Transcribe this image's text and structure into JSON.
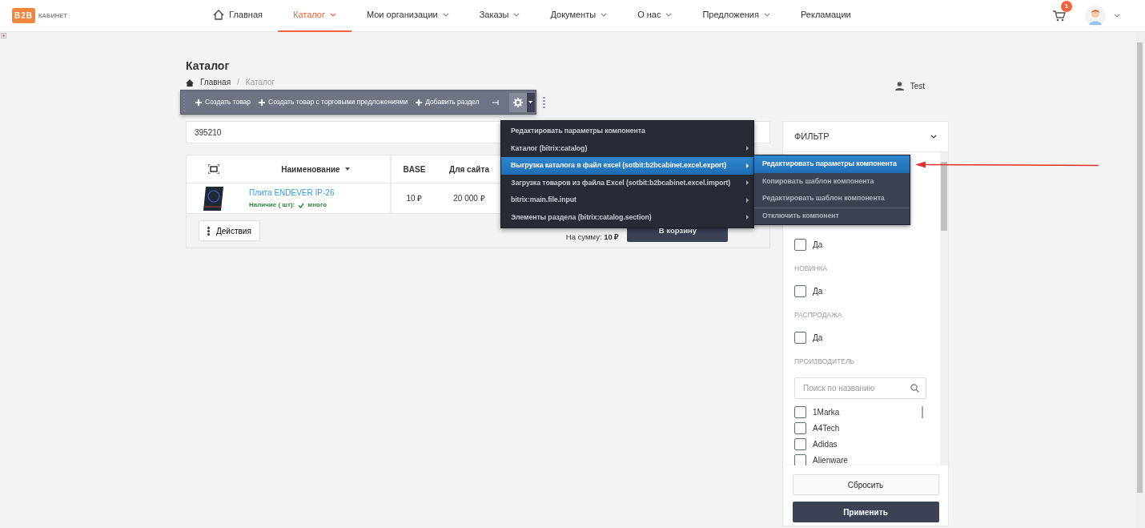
{
  "header": {
    "logo_mark": "B2B",
    "logo_text": "КАБИНЕТ",
    "cart_count": "1",
    "nav": [
      {
        "label": "Главная",
        "kind": "home",
        "selected": false,
        "dropdown": false
      },
      {
        "label": "Каталог",
        "kind": "link",
        "selected": true,
        "dropdown": true
      },
      {
        "label": "Мои организации",
        "kind": "link",
        "selected": false,
        "dropdown": true
      },
      {
        "label": "Заказы",
        "kind": "link",
        "selected": false,
        "dropdown": true
      },
      {
        "label": "Документы",
        "kind": "link",
        "selected": false,
        "dropdown": true
      },
      {
        "label": "О нас",
        "kind": "link",
        "selected": false,
        "dropdown": true
      },
      {
        "label": "Предложения",
        "kind": "link",
        "selected": false,
        "dropdown": true
      },
      {
        "label": "Рекламации",
        "kind": "link",
        "selected": false,
        "dropdown": false
      }
    ]
  },
  "page": {
    "title": "Каталог",
    "breadcrumbs": [
      "Главная",
      "Каталог"
    ],
    "breadcrumb_separator": "/",
    "user": "Test"
  },
  "toolbar": {
    "buttons": [
      "Создать товар",
      "Создать товар с торговыми предложениями",
      "Добавить раздел"
    ]
  },
  "search": {
    "value": "395210"
  },
  "table": {
    "columns": [
      {
        "label": "Наименование",
        "sortable": true
      },
      {
        "label": "BASE",
        "sortable": false
      },
      {
        "label": "Для сайта",
        "sortable": false
      }
    ],
    "rows": [
      {
        "name": "Плита ENDEVER IP-26",
        "stock_label": "Наличие ( шт):",
        "stock": "много",
        "base": "10 ₽",
        "site": "20 000 ₽"
      }
    ],
    "actions": "Действия",
    "total_label": "На сумму:",
    "total": "10 ₽",
    "cart_button": "В корзину"
  },
  "context_menu": {
    "items": [
      {
        "label": "Редактировать параметры компонента",
        "submenu": false,
        "selected": false
      },
      {
        "label": "Каталог (bitrix:catalog)",
        "submenu": true,
        "selected": false
      },
      {
        "label": "Выгрузка каталога в файл excel (sotbit:b2bcabinet.excel.export)",
        "submenu": true,
        "selected": true
      },
      {
        "label": "Загрузка товаров из файла Excel (sotbit:b2bcabinet.excel.import)",
        "submenu": true,
        "selected": false
      },
      {
        "label": "bitrix:main.file.input",
        "submenu": true,
        "selected": false
      },
      {
        "label": "Элементы раздела (bitrix:catalog.section)",
        "submenu": true,
        "selected": false
      }
    ],
    "submenu": [
      {
        "label": "Редактировать параметры компонента",
        "selected": true,
        "divider_before": false
      },
      {
        "label": "Копировать шаблон компонента",
        "selected": false,
        "divider_before": false
      },
      {
        "label": "Редактировать шаблон компонента",
        "selected": false,
        "divider_before": false
      },
      {
        "label": "Отключить компонент",
        "selected": false,
        "divider_before": true
      }
    ]
  },
  "filter": {
    "title": "ФИЛЬТР",
    "groups": [
      {
        "kind": "checkbox",
        "options": [
          {
            "label": "Да",
            "checked": false
          }
        ]
      },
      {
        "kind": "checkbox",
        "heading": "НОВИНКА",
        "options": [
          {
            "label": "Да",
            "checked": false
          }
        ]
      },
      {
        "kind": "checkbox",
        "heading": "РАСПРОДАЖА",
        "options": [
          {
            "label": "Да",
            "checked": false
          }
        ]
      },
      {
        "kind": "search_list",
        "heading": "ПРОИЗВОДИТЕЛЬ",
        "placeholder": "Поиск по названию",
        "options": [
          {
            "label": "1Marka",
            "checked": false
          },
          {
            "label": "A4Tech",
            "checked": false
          },
          {
            "label": "Adidas",
            "checked": false
          },
          {
            "label": "Alienware",
            "checked": false
          }
        ]
      }
    ],
    "reset": "Сбросить",
    "apply": "Применить"
  }
}
